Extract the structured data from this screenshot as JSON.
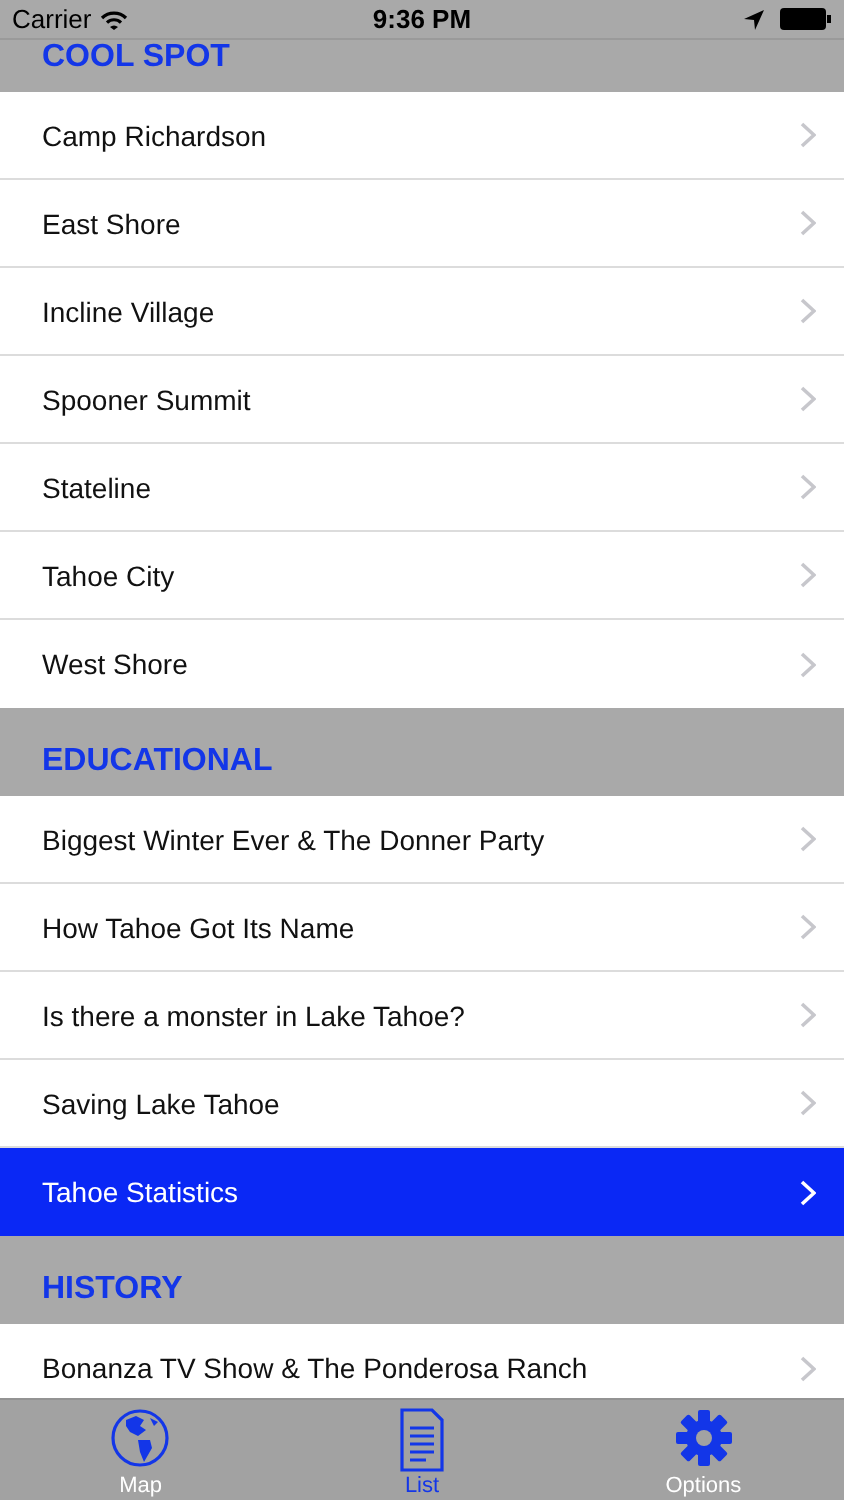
{
  "status_bar": {
    "carrier": "Carrier",
    "time": "9:36 PM"
  },
  "sections": [
    {
      "title": "COOL SPOT",
      "rows": [
        {
          "label": "Camp Richardson",
          "selected": false
        },
        {
          "label": "East Shore",
          "selected": false
        },
        {
          "label": "Incline Village",
          "selected": false
        },
        {
          "label": "Spooner Summit",
          "selected": false
        },
        {
          "label": "Stateline",
          "selected": false
        },
        {
          "label": "Tahoe City",
          "selected": false
        },
        {
          "label": "West Shore",
          "selected": false
        }
      ]
    },
    {
      "title": "EDUCATIONAL",
      "rows": [
        {
          "label": "Biggest Winter Ever & The Donner Party",
          "selected": false
        },
        {
          "label": "How Tahoe Got Its Name",
          "selected": false
        },
        {
          "label": "Is there a monster in Lake Tahoe?",
          "selected": false
        },
        {
          "label": "Saving Lake Tahoe",
          "selected": false
        },
        {
          "label": "Tahoe Statistics",
          "selected": true
        }
      ]
    },
    {
      "title": "HISTORY",
      "rows": [
        {
          "label": "Bonanza TV Show & The Ponderosa Ranch",
          "selected": false
        }
      ]
    }
  ],
  "tab_bar": [
    {
      "kind": "map",
      "label": "Map",
      "selected": false
    },
    {
      "kind": "list",
      "label": "List",
      "selected": true
    },
    {
      "kind": "options",
      "label": "Options",
      "selected": false
    }
  ]
}
